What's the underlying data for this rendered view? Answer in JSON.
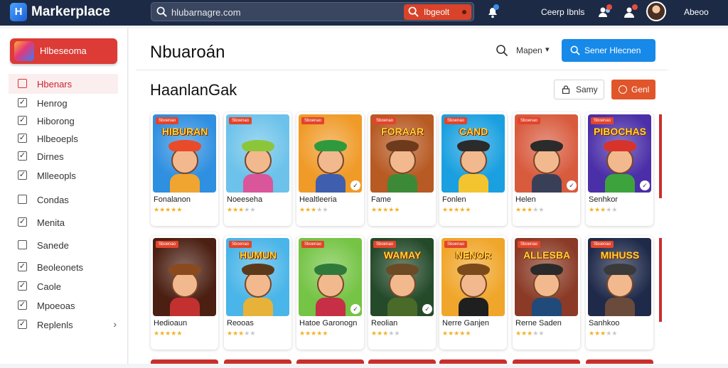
{
  "header": {
    "brand": "Markerplace",
    "search_value": "hlubarnagre.com",
    "search_button": "Ibgeolt",
    "link": "Ceerp Ibnls",
    "user_label": "Abeoo"
  },
  "sidebar": {
    "category_button": "Hlbeseoma",
    "filters": [
      {
        "label": "Hbenars",
        "checked": false,
        "active": true
      },
      {
        "label": "Henrog",
        "checked": true
      },
      {
        "label": "Hiborong",
        "checked": true
      },
      {
        "label": "Hlbeoepls",
        "checked": true
      },
      {
        "label": "Dirnes",
        "checked": true
      },
      {
        "label": "Mlleeopls",
        "checked": true
      },
      {
        "label": "Condas",
        "checked": false
      },
      {
        "label": "Menita",
        "checked": true
      },
      {
        "label": "Sanede",
        "checked": false
      },
      {
        "label": "Beoleonets",
        "checked": true
      },
      {
        "label": "Caole",
        "checked": true
      },
      {
        "label": "Mpoeoas",
        "checked": true
      },
      {
        "label": "Replenls",
        "checked": true
      }
    ]
  },
  "main": {
    "title": "Nbuaroán",
    "section_title": "HaanlanGak",
    "map_label": "Mapen",
    "primary_button": "Sener Hlecnen",
    "secondary_button": "Samy",
    "orange_button": "Genl"
  },
  "cards": [
    {
      "art_title": "HIBURAN",
      "name": "Fonalanon",
      "rating": 5,
      "bg": "#2f8fe0",
      "hat": "#e84a2a",
      "shirt": "#f0a531",
      "check": false
    },
    {
      "art_title": "",
      "name": "Noeeseha",
      "rating": 3,
      "bg": "#6cc2ea",
      "hat": "#8bc63a",
      "shirt": "#d9569b",
      "check": false
    },
    {
      "art_title": "",
      "name": "Healtleeria",
      "rating": 3,
      "bg": "#f09a27",
      "hat": "#2f9a3d",
      "shirt": "#3f5fae",
      "check": true
    },
    {
      "art_title": "FORAAR",
      "name": "Fame",
      "rating": 5,
      "bg": "#b75a23",
      "hat": "#6e3a1c",
      "shirt": "#3c8a37",
      "check": false
    },
    {
      "art_title": "CAND",
      "name": "Fonlen",
      "rating": 5,
      "bg": "#1aa0e0",
      "hat": "#2b2b2b",
      "shirt": "#f4c430",
      "check": false
    },
    {
      "art_title": "",
      "name": "Helen",
      "rating": 3,
      "bg": "#d85b3e",
      "hat": "#2b2b2b",
      "shirt": "#3a3f58",
      "check": true
    },
    {
      "art_title": "PIBOCHAS",
      "name": "Senhkor",
      "rating": 3,
      "bg": "#4b2fa8",
      "hat": "#d7332a",
      "shirt": "#3da33c",
      "check": true
    },
    {
      "art_title": "",
      "name": "Hedioaun",
      "rating": 5,
      "bg": "#4b1f12",
      "hat": "#8a4a1e",
      "shirt": "#c23030",
      "check": false
    },
    {
      "art_title": "HUMUN",
      "name": "Reooas",
      "rating": 3,
      "bg": "#49b5e8",
      "hat": "#5a3a1a",
      "shirt": "#e7b23a",
      "check": false
    },
    {
      "art_title": "",
      "name": "Hatoe Garonogn",
      "rating": 5,
      "bg": "#75c445",
      "hat": "#2f7a3a",
      "shirt": "#c62f45",
      "check": true
    },
    {
      "art_title": "WAMAY",
      "name": "Reolian",
      "rating": 3,
      "bg": "#244a2a",
      "hat": "#6b4a25",
      "shirt": "#4a6a2a",
      "check": true
    },
    {
      "art_title": "NENOR",
      "name": "Nerre Ganjen",
      "rating": 5,
      "bg": "#f0a62a",
      "hat": "#7a4a1a",
      "shirt": "#1f1f1f",
      "check": false
    },
    {
      "art_title": "ALLESBA",
      "name": "Rerne Saden",
      "rating": 3,
      "bg": "#8a3a26",
      "hat": "#2a2a2a",
      "shirt": "#1f4a7a",
      "check": false
    },
    {
      "art_title": "MIHUSS",
      "name": "Sanhkoo",
      "rating": 3,
      "bg": "#1f2a4a",
      "hat": "#3a3a3a",
      "shirt": "#6a4a3a",
      "check": false
    }
  ],
  "tag_text": "Sboenao"
}
